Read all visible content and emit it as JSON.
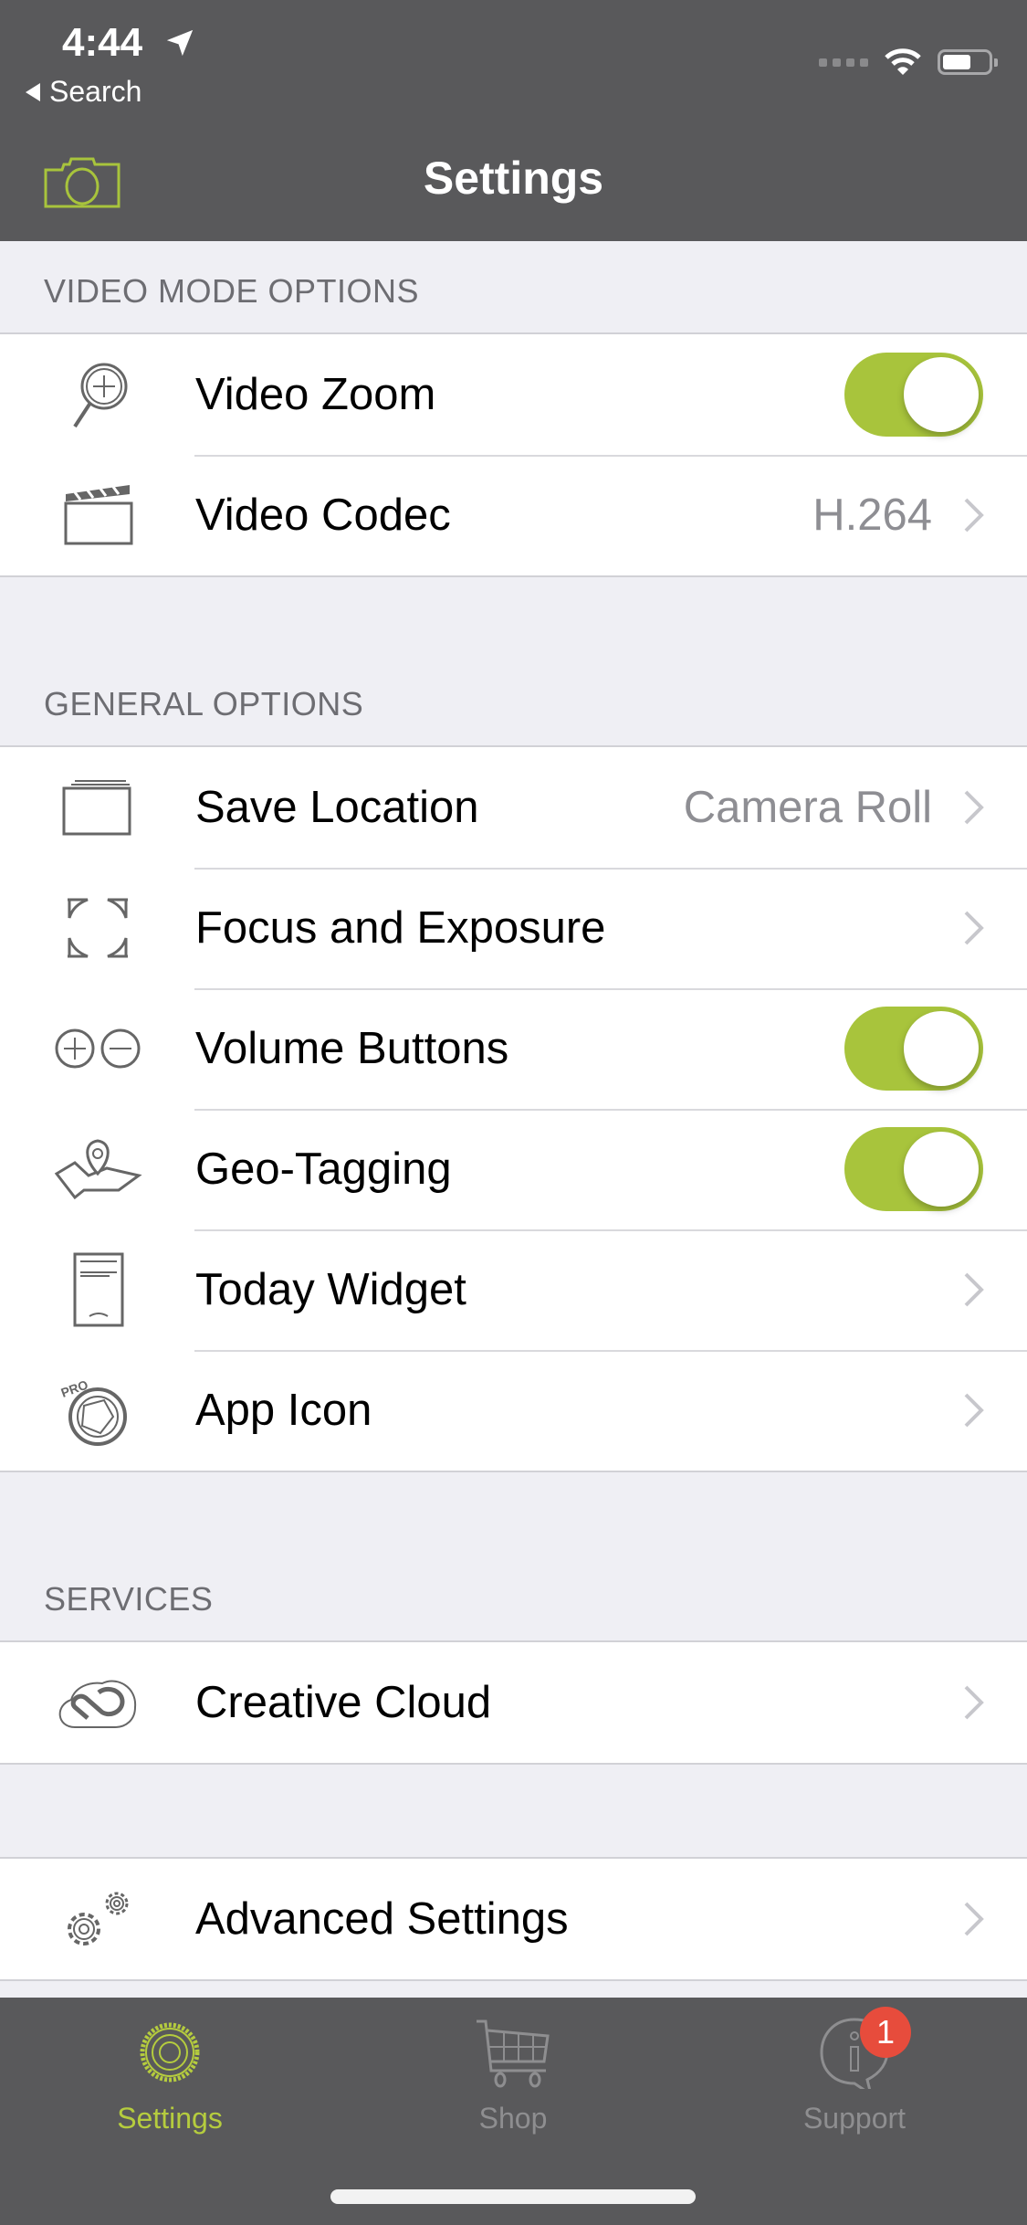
{
  "status_bar": {
    "time": "4:44",
    "back_label": "Search"
  },
  "nav": {
    "title": "Settings"
  },
  "sections": [
    {
      "header": "VIDEO MODE OPTIONS",
      "rows": [
        {
          "label": "Video Zoom",
          "icon": "magnifier-plus-icon",
          "type": "toggle",
          "on": true
        },
        {
          "label": "Video Codec",
          "icon": "clapperboard-icon",
          "type": "disclosure",
          "value": "H.264"
        }
      ]
    },
    {
      "header": "GENERAL OPTIONS",
      "rows": [
        {
          "label": "Save Location",
          "icon": "photo-stack-icon",
          "type": "disclosure",
          "value": "Camera Roll"
        },
        {
          "label": "Focus and Exposure",
          "icon": "focus-brackets-icon",
          "type": "disclosure"
        },
        {
          "label": "Volume Buttons",
          "icon": "plus-minus-icon",
          "type": "toggle",
          "on": true
        },
        {
          "label": "Geo-Tagging",
          "icon": "map-pin-icon",
          "type": "toggle",
          "on": true
        },
        {
          "label": "Today Widget",
          "icon": "widget-icon",
          "type": "disclosure"
        },
        {
          "label": "App Icon",
          "icon": "procamera-icon",
          "type": "disclosure",
          "icon_text": "PROCAMERA"
        }
      ]
    },
    {
      "header": "SERVICES",
      "rows": [
        {
          "label": "Creative Cloud",
          "icon": "creative-cloud-icon",
          "type": "disclosure"
        }
      ]
    },
    {
      "header": "",
      "rows": [
        {
          "label": "Advanced Settings",
          "icon": "gears-icon",
          "type": "disclosure"
        }
      ]
    }
  ],
  "tabbar": {
    "tabs": [
      {
        "label": "Settings",
        "icon": "settings-dial-icon",
        "active": true
      },
      {
        "label": "Shop",
        "icon": "cart-icon",
        "active": false
      },
      {
        "label": "Support",
        "icon": "info-bubble-icon",
        "active": false,
        "badge": "1"
      }
    ]
  },
  "colors": {
    "accent": "#a8c43c",
    "bar_bg": "#59595b",
    "badge": "#e74c3c",
    "inactive": "#8e8e90"
  }
}
